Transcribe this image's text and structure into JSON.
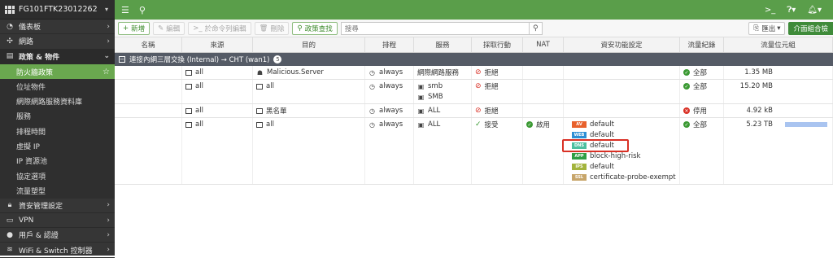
{
  "device": {
    "name": "FG101FTK23012262"
  },
  "sidebar": {
    "items": [
      {
        "icon": "dashboard-icon",
        "label": "儀表板",
        "arrow": "›"
      },
      {
        "icon": "network-icon",
        "label": "網路",
        "arrow": "›"
      },
      {
        "icon": "policy-icon",
        "label": "政策 & 物件",
        "arrow": "⌄"
      }
    ],
    "sub": [
      {
        "label": "防火牆政策",
        "active": true
      },
      {
        "label": "位址物件"
      },
      {
        "label": "網際網路服務資料庫"
      },
      {
        "label": "服務"
      },
      {
        "label": "排程時間"
      },
      {
        "label": "虛擬 IP"
      },
      {
        "label": "IP 資源池"
      },
      {
        "label": "協定選項"
      },
      {
        "label": "流量塑型"
      }
    ],
    "bottom": [
      {
        "icon": "lock-icon",
        "label": "資安管理設定",
        "arrow": "›"
      },
      {
        "icon": "vpn-icon",
        "label": "VPN",
        "arrow": "›"
      },
      {
        "icon": "user-icon",
        "label": "用戶 & 認證",
        "arrow": "›"
      },
      {
        "icon": "wifi-icon",
        "label": "WiFi & Switch 控制器",
        "arrow": "›"
      }
    ]
  },
  "toolbar": {
    "new": "新增",
    "edit": "編輯",
    "cli": "於命令列編輯",
    "delete": "刪除",
    "policy_lookup": "政策查找",
    "search_placeholder": "搜尋",
    "export": "匯出",
    "interface_pair": "介面組合檢"
  },
  "columns": [
    "名稱",
    "來源",
    "目的",
    "排程",
    "服務",
    "採取行動",
    "NAT",
    "資安功能設定",
    "流量紀錄",
    "流量位元組"
  ],
  "group": {
    "label": "連接內網三層交換 (Internal) → CHT (wan1)",
    "count": "5"
  },
  "rows": [
    {
      "src": "all",
      "dst": "Malicious.Server",
      "schedule": "always",
      "services": [
        "網際網路服務"
      ],
      "action": "拒絕",
      "log": "全部",
      "bytes": "1.35 MB"
    },
    {
      "src": "all",
      "dst": "all",
      "schedule": "always",
      "services": [
        "smb",
        "SMB"
      ],
      "action": "拒絕",
      "log": "全部",
      "bytes": "15.20 MB"
    },
    {
      "src": "all",
      "dst": "黑名單",
      "schedule": "always",
      "services": [
        "ALL"
      ],
      "action": "拒絕",
      "log": "停用",
      "bytes": "4.92 kB"
    },
    {
      "src": "all",
      "dst": "all",
      "schedule": "always",
      "services": [
        "ALL"
      ],
      "action": "接受",
      "nat": "啟用",
      "log": "全部",
      "bytes": "5.23 TB",
      "profiles": [
        {
          "tag": "AV",
          "color": "#e8612c",
          "name": "default"
        },
        {
          "tag": "WEB",
          "color": "#2d8fd5",
          "name": "default"
        },
        {
          "tag": "DNS",
          "color": "#4dbfa0",
          "name": "default"
        },
        {
          "tag": "APP",
          "color": "#2f9e44",
          "name": "block-high-risk"
        },
        {
          "tag": "IPS",
          "color": "#a3b43c",
          "name": "default"
        },
        {
          "tag": "SSL",
          "color": "#c7a56a",
          "name": "certificate-probe-exempt"
        }
      ]
    }
  ],
  "colors": {
    "accent": "#5a9e4a",
    "traffic_bar": "#a9c4f0"
  }
}
